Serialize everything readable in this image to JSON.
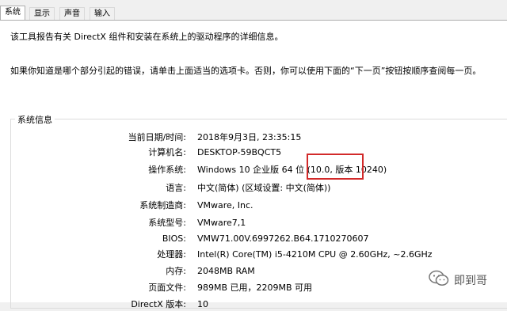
{
  "tabs": [
    "系统",
    "显示",
    "声音",
    "输入"
  ],
  "intro": [
    "该工具报告有关 DirectX 组件和安装在系统上的驱动程序的详细信息。",
    "如果你知道是哪个部分引起的错误，请单击上面适当的选项卡。否则，你可以使用下面的“下一页”按钮按顺序查阅每一页。"
  ],
  "group_title": "系统信息",
  "rows": [
    {
      "label": "当前日期/时间:",
      "value": "2018年9月3日, 23:35:15"
    },
    {
      "label": "计算机名:",
      "value": "DESKTOP-59BQCT5"
    },
    {
      "label": "操作系统:",
      "value": "Windows 10 企业版 64 位 (10.0, 版本 10240)"
    },
    {
      "label": "语言:",
      "value": "中文(简体) (区域设置: 中文(简体))"
    },
    {
      "label": "系统制造商:",
      "value": "VMware, Inc."
    },
    {
      "label": "系统型号:",
      "value": "VMware7,1"
    },
    {
      "label": "BIOS:",
      "value": "VMW71.00V.6997262.B64.1710270607"
    },
    {
      "label": "处理器:",
      "value": "Intel(R) Core(TM) i5-4210M CPU @ 2.60GHz, ~2.6GHz"
    },
    {
      "label": "内存:",
      "value": "2048MB RAM"
    },
    {
      "label": "页面文件:",
      "value": "989MB 已用，2209MB 可用"
    },
    {
      "label": "DirectX 版本:",
      "value": "10"
    }
  ],
  "watermark": "即到哥",
  "watermark_icon": "wechat-icon",
  "highlight_color": "#d22a2a"
}
